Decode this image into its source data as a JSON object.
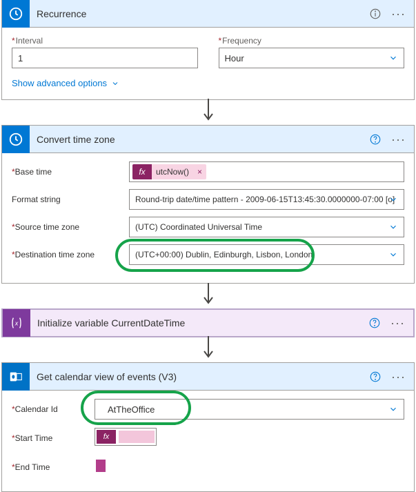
{
  "recurrence": {
    "title": "Recurrence",
    "interval_label": "Interval",
    "interval_value": "1",
    "frequency_label": "Frequency",
    "frequency_value": "Hour",
    "advanced": "Show advanced options"
  },
  "convert": {
    "title": "Convert time zone",
    "base_time_label": "Base time",
    "base_time_token": "utcNow()",
    "fx_label": "fx",
    "format_label": "Format string",
    "format_value": "Round-trip date/time pattern - 2009-06-15T13:45:30.0000000-07:00 [o]",
    "source_label": "Source time zone",
    "source_value": "(UTC) Coordinated Universal Time",
    "dest_label": "Destination time zone",
    "dest_value": "(UTC+00:00) Dublin, Edinburgh, Lisbon, London"
  },
  "initvar": {
    "title": "Initialize variable CurrentDateTime"
  },
  "calendar": {
    "title": "Get calendar view of events (V3)",
    "calendar_id_label": "Calendar Id",
    "calendar_id_value": "AtTheOffice",
    "start_label": "Start Time",
    "end_label": "End Time",
    "fx_label": "fx"
  },
  "glyph": {
    "star": "*"
  }
}
